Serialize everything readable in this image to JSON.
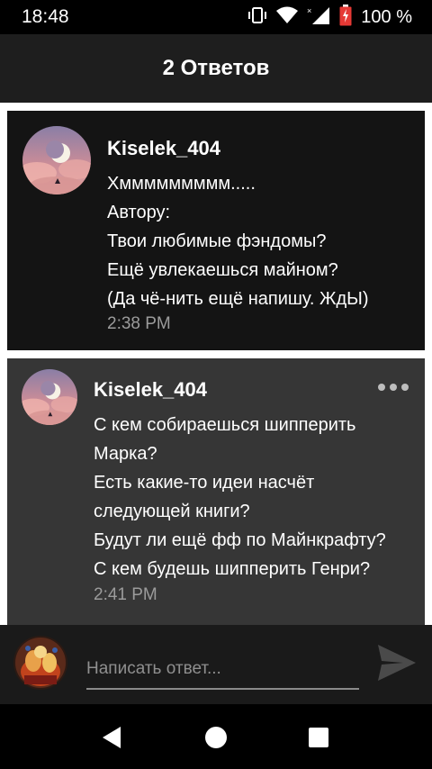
{
  "status": {
    "time": "18:48",
    "battery": "100 %",
    "icons": [
      "vibrate-icon",
      "wifi-icon",
      "signal-icon",
      "battery-icon"
    ]
  },
  "header": {
    "title": "2 Ответов"
  },
  "comment": {
    "username": "Kiselek_404",
    "lines": [
      "Хммммммммм.....",
      "Автору:",
      "Твои любимые фэндомы?",
      "Ещё увлекаешься майном?",
      "(Да чё-нить ещё напишу. ЖдЫ)"
    ],
    "time": "2:38 PM"
  },
  "reply": {
    "username": "Kiselek_404",
    "lines": [
      "С кем собираешься шипперить",
      "Марка?",
      "Есть какие-то идеи насчёт",
      "следующей книги?",
      "Будут ли ещё фф по Майнкрафту?",
      "С кем будешь шипперить Генри?"
    ],
    "time": "2:41 PM"
  },
  "compose": {
    "placeholder": "Написать ответ..."
  },
  "colors": {
    "accent_text": "#ffffff",
    "time_text": "#9b9b9b",
    "header_bg": "#1e1e1e",
    "reply_bg": "#363636"
  }
}
